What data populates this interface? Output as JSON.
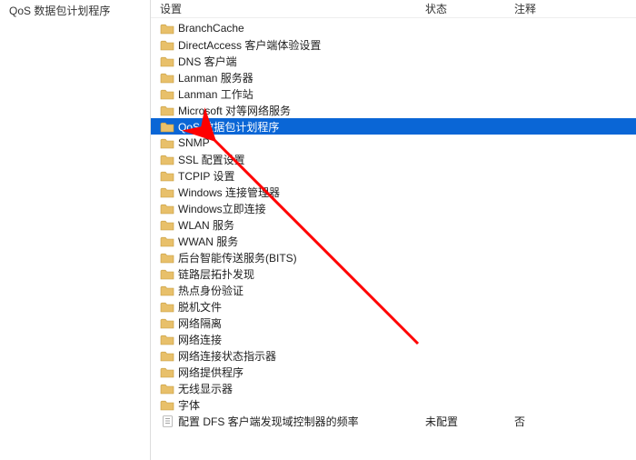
{
  "left": {
    "title": "QoS 数据包计划程序"
  },
  "header": {
    "setting": "设置",
    "state": "状态",
    "comment": "注释"
  },
  "items": [
    {
      "label": "BranchCache",
      "icon": "folder",
      "selected": false,
      "state": "",
      "comment": ""
    },
    {
      "label": "DirectAccess 客户端体验设置",
      "icon": "folder",
      "selected": false,
      "state": "",
      "comment": ""
    },
    {
      "label": "DNS 客户端",
      "icon": "folder",
      "selected": false,
      "state": "",
      "comment": ""
    },
    {
      "label": "Lanman 服务器",
      "icon": "folder",
      "selected": false,
      "state": "",
      "comment": ""
    },
    {
      "label": "Lanman 工作站",
      "icon": "folder",
      "selected": false,
      "state": "",
      "comment": ""
    },
    {
      "label": "Microsoft 对等网络服务",
      "icon": "folder",
      "selected": false,
      "state": "",
      "comment": ""
    },
    {
      "label": "QoS 数据包计划程序",
      "icon": "folder",
      "selected": true,
      "state": "",
      "comment": ""
    },
    {
      "label": "SNMP",
      "icon": "folder",
      "selected": false,
      "state": "",
      "comment": ""
    },
    {
      "label": "SSL 配置设置",
      "icon": "folder",
      "selected": false,
      "state": "",
      "comment": ""
    },
    {
      "label": "TCPIP 设置",
      "icon": "folder",
      "selected": false,
      "state": "",
      "comment": ""
    },
    {
      "label": "Windows 连接管理器",
      "icon": "folder",
      "selected": false,
      "state": "",
      "comment": ""
    },
    {
      "label": "Windows立即连接",
      "icon": "folder",
      "selected": false,
      "state": "",
      "comment": ""
    },
    {
      "label": "WLAN 服务",
      "icon": "folder",
      "selected": false,
      "state": "",
      "comment": ""
    },
    {
      "label": "WWAN 服务",
      "icon": "folder",
      "selected": false,
      "state": "",
      "comment": ""
    },
    {
      "label": "后台智能传送服务(BITS)",
      "icon": "folder",
      "selected": false,
      "state": "",
      "comment": ""
    },
    {
      "label": "链路层拓扑发现",
      "icon": "folder",
      "selected": false,
      "state": "",
      "comment": ""
    },
    {
      "label": "热点身份验证",
      "icon": "folder",
      "selected": false,
      "state": "",
      "comment": ""
    },
    {
      "label": "脱机文件",
      "icon": "folder",
      "selected": false,
      "state": "",
      "comment": ""
    },
    {
      "label": "网络隔离",
      "icon": "folder",
      "selected": false,
      "state": "",
      "comment": ""
    },
    {
      "label": "网络连接",
      "icon": "folder",
      "selected": false,
      "state": "",
      "comment": ""
    },
    {
      "label": "网络连接状态指示器",
      "icon": "folder",
      "selected": false,
      "state": "",
      "comment": ""
    },
    {
      "label": "网络提供程序",
      "icon": "folder",
      "selected": false,
      "state": "",
      "comment": ""
    },
    {
      "label": "无线显示器",
      "icon": "folder",
      "selected": false,
      "state": "",
      "comment": ""
    },
    {
      "label": "字体",
      "icon": "folder",
      "selected": false,
      "state": "",
      "comment": ""
    },
    {
      "label": "配置 DFS 客户端发现域控制器的频率",
      "icon": "setting",
      "selected": false,
      "state": "未配置",
      "comment": "否"
    }
  ]
}
